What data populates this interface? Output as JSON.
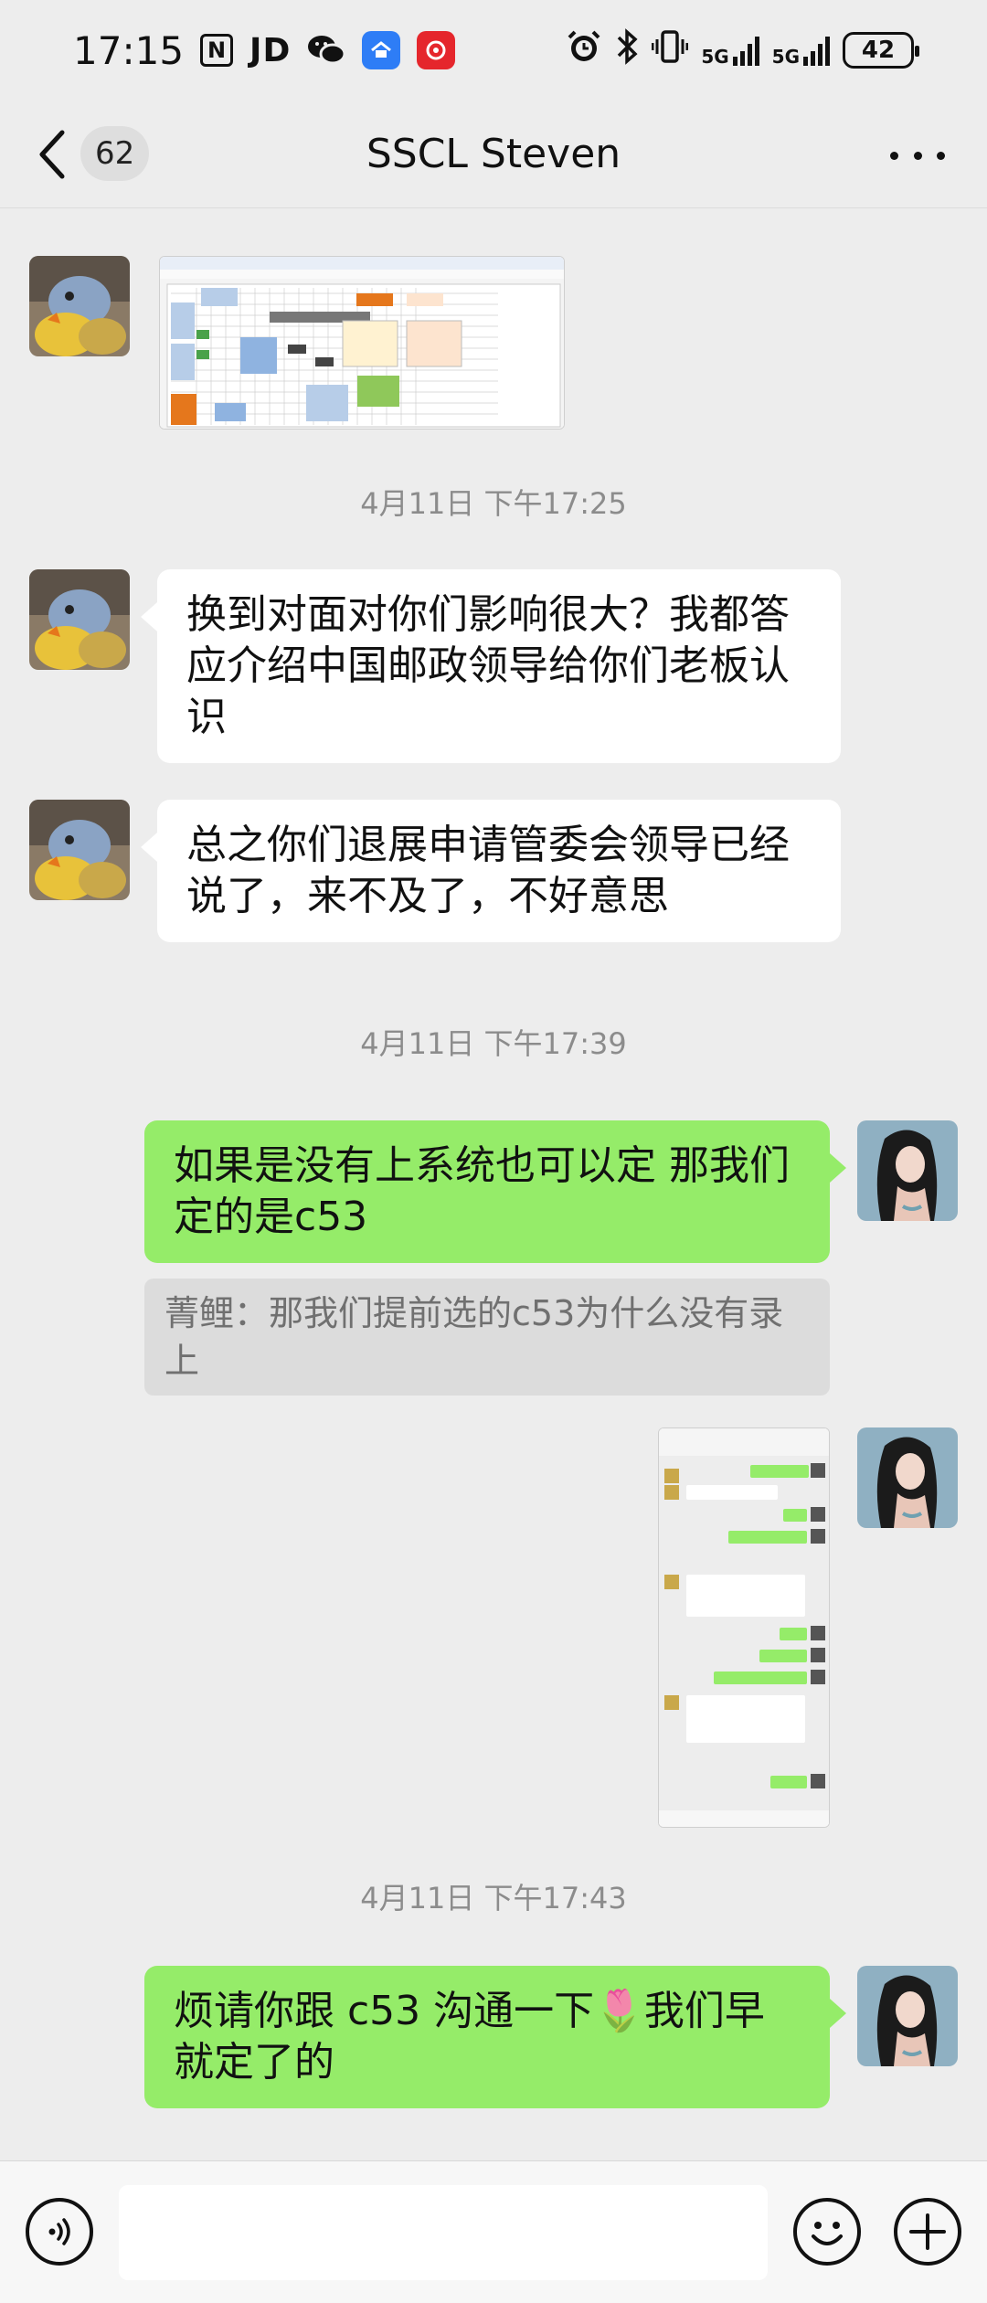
{
  "status_bar": {
    "time": "17:15",
    "nfc": "N",
    "jd": "JD",
    "network_1": "5G",
    "network_2": "5G",
    "battery": "42",
    "icons": [
      "nfc-icon",
      "jd-icon",
      "wechat-icon",
      "ai-scan-app-icon",
      "red-app-icon",
      "alarm-icon",
      "bluetooth-icon",
      "vibrate-icon",
      "signal-icon",
      "battery-icon"
    ]
  },
  "nav": {
    "back_icon": "chevron-left-icon",
    "unread_count": "62",
    "title": "SSCL Steven",
    "more_icon": "more-dots-icon"
  },
  "messages": [
    {
      "type": "image",
      "side": "in",
      "description_icon": "spreadsheet-floorplan-image"
    },
    {
      "type": "timestamp",
      "text": "4月11日 下午17:25"
    },
    {
      "type": "text",
      "side": "in",
      "text": "换到对面对你们影响很大？我都答应介绍中国邮政领导给你们老板认识"
    },
    {
      "type": "text",
      "side": "in",
      "text": "总之你们退展申请管委会领导已经说了，来不及了，不好意思"
    },
    {
      "type": "timestamp",
      "text": "4月11日 下午17:39"
    },
    {
      "type": "text",
      "side": "out",
      "text": "如果是没有上系统也可以定 那我们定的是c53",
      "quote": "菁鲤：那我们提前选的c53为什么没有录上"
    },
    {
      "type": "image",
      "side": "out",
      "description_icon": "chat-screenshot-image"
    },
    {
      "type": "timestamp",
      "text": "4月11日 下午17:43"
    },
    {
      "type": "text",
      "side": "out",
      "text": "烦请你跟 c53 沟通一下🌷我们早就定了的"
    }
  ],
  "input_bar": {
    "placeholder": "",
    "voice_icon": "voice-icon",
    "emoji_icon": "emoji-icon",
    "plus_icon": "plus-icon"
  },
  "colors": {
    "background": "#ededed",
    "out_bubble": "#95ec69",
    "in_bubble": "#ffffff",
    "timestamp": "#8c8c8c"
  }
}
